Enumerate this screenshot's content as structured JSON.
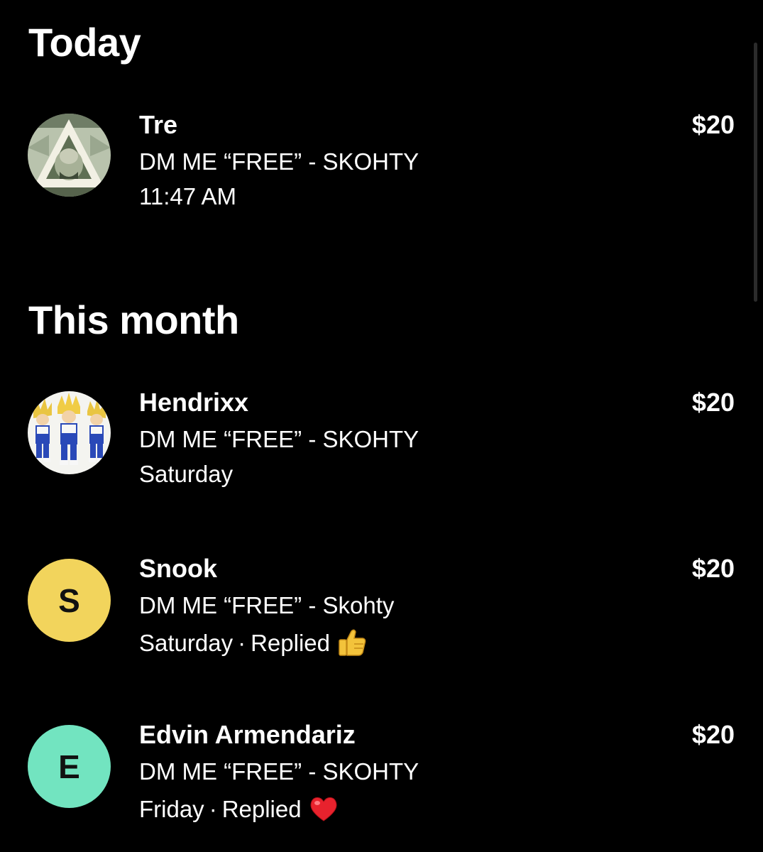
{
  "sections": [
    {
      "title": "Today",
      "items": [
        {
          "name": "Tre",
          "message": "DM ME “FREE” - SKOHTY",
          "time": "11:47 AM",
          "amount": "$20",
          "avatar": "dollar-pyramid-photo"
        }
      ]
    },
    {
      "title": "This month",
      "items": [
        {
          "name": "Hendrixx",
          "message": "DM ME “FREE” - SKOHTY",
          "time": "Saturday",
          "amount": "$20",
          "avatar": "anime-characters-photo"
        },
        {
          "name": "Snook",
          "message": "DM ME “FREE” - Skohty",
          "time": "Saturday",
          "separator": "·",
          "status": "Replied",
          "reaction": "thumbs-up-icon",
          "amount": "$20",
          "avatar_letter": "S",
          "avatar_color": "#f2d45c"
        },
        {
          "name": "Edvin Armendariz",
          "message": "DM ME “FREE” - SKOHTY",
          "time": "Friday",
          "separator": "·",
          "status": "Replied",
          "reaction": "red-heart-icon",
          "amount": "$20",
          "avatar_letter": "E",
          "avatar_color": "#72e4c0"
        }
      ]
    }
  ]
}
